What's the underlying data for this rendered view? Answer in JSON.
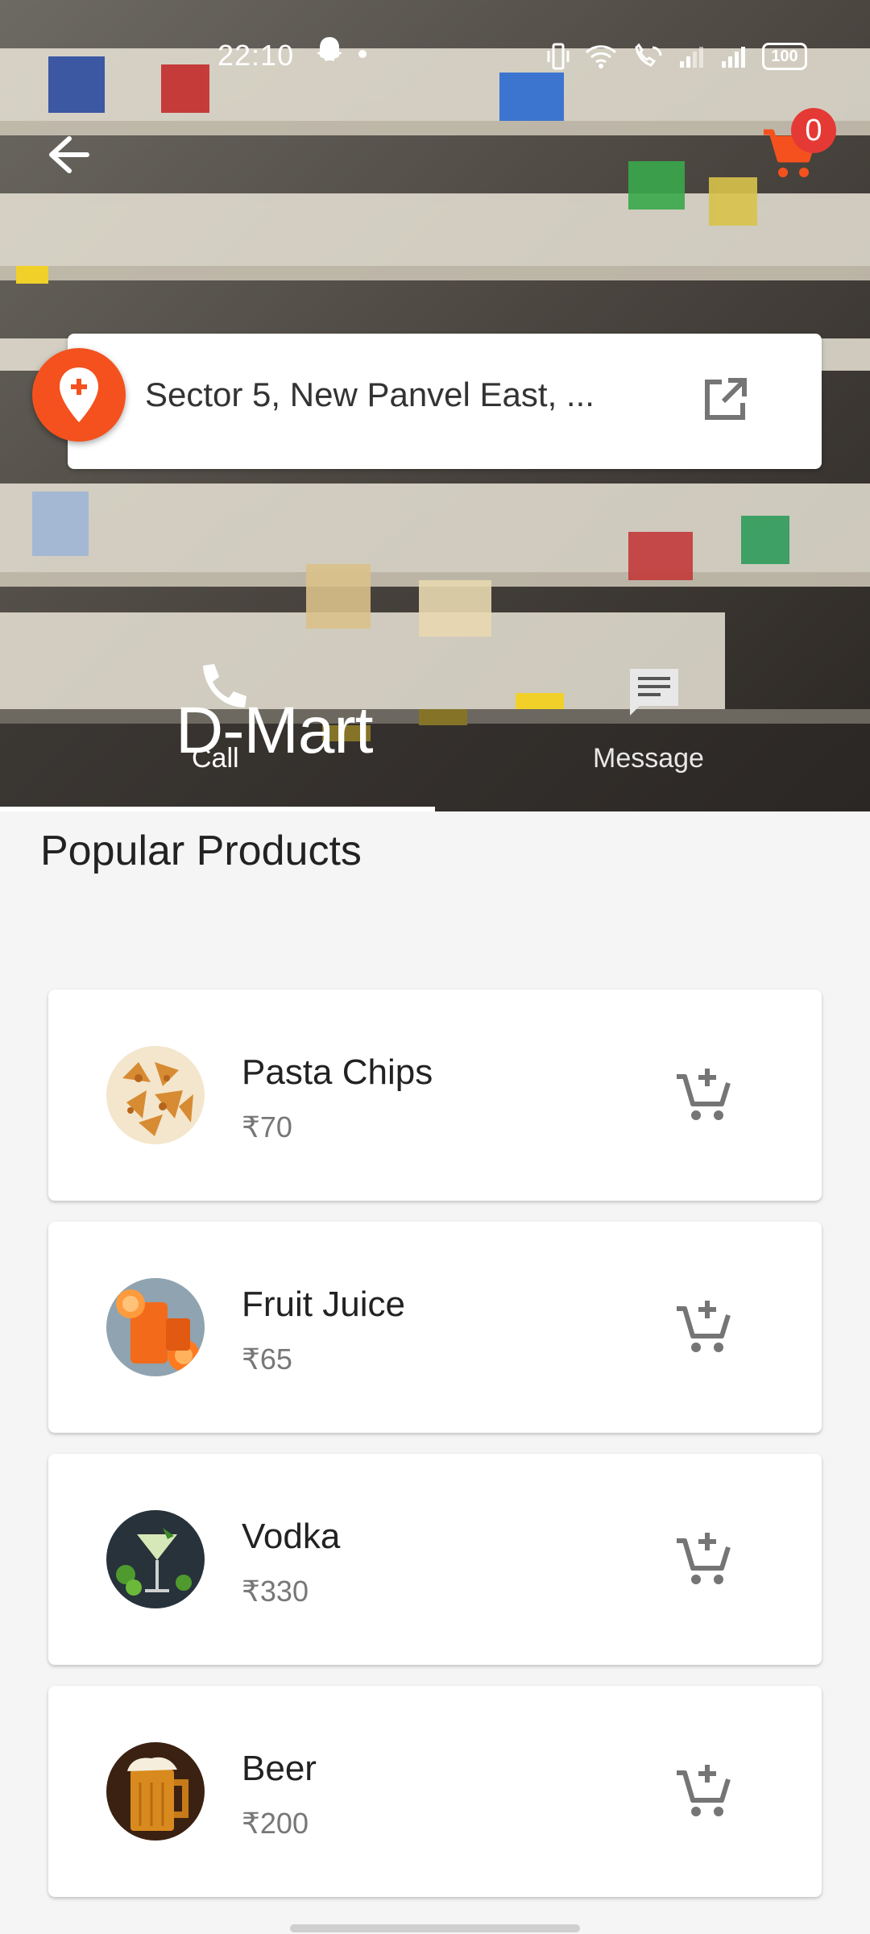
{
  "status_bar": {
    "time": "22:10",
    "battery": "100"
  },
  "header": {
    "cart_count": "0"
  },
  "store": {
    "name": "D-Mart",
    "address": "Sector 5, New Panvel East, ..."
  },
  "tabs": [
    {
      "label": "Call",
      "icon": "phone-icon"
    },
    {
      "label": "Message",
      "icon": "message-icon"
    }
  ],
  "section_title": "Popular Products",
  "products": [
    {
      "name": "Pasta Chips",
      "price": "₹70",
      "thumb": "chips"
    },
    {
      "name": "Fruit Juice",
      "price": "₹65",
      "thumb": "juice"
    },
    {
      "name": "Vodka",
      "price": "₹330",
      "thumb": "cocktail"
    },
    {
      "name": "Beer",
      "price": "₹200",
      "thumb": "beer"
    }
  ],
  "colors": {
    "accent": "#f4511e",
    "badge": "#e53935",
    "cart_icon": "#f4511e"
  }
}
